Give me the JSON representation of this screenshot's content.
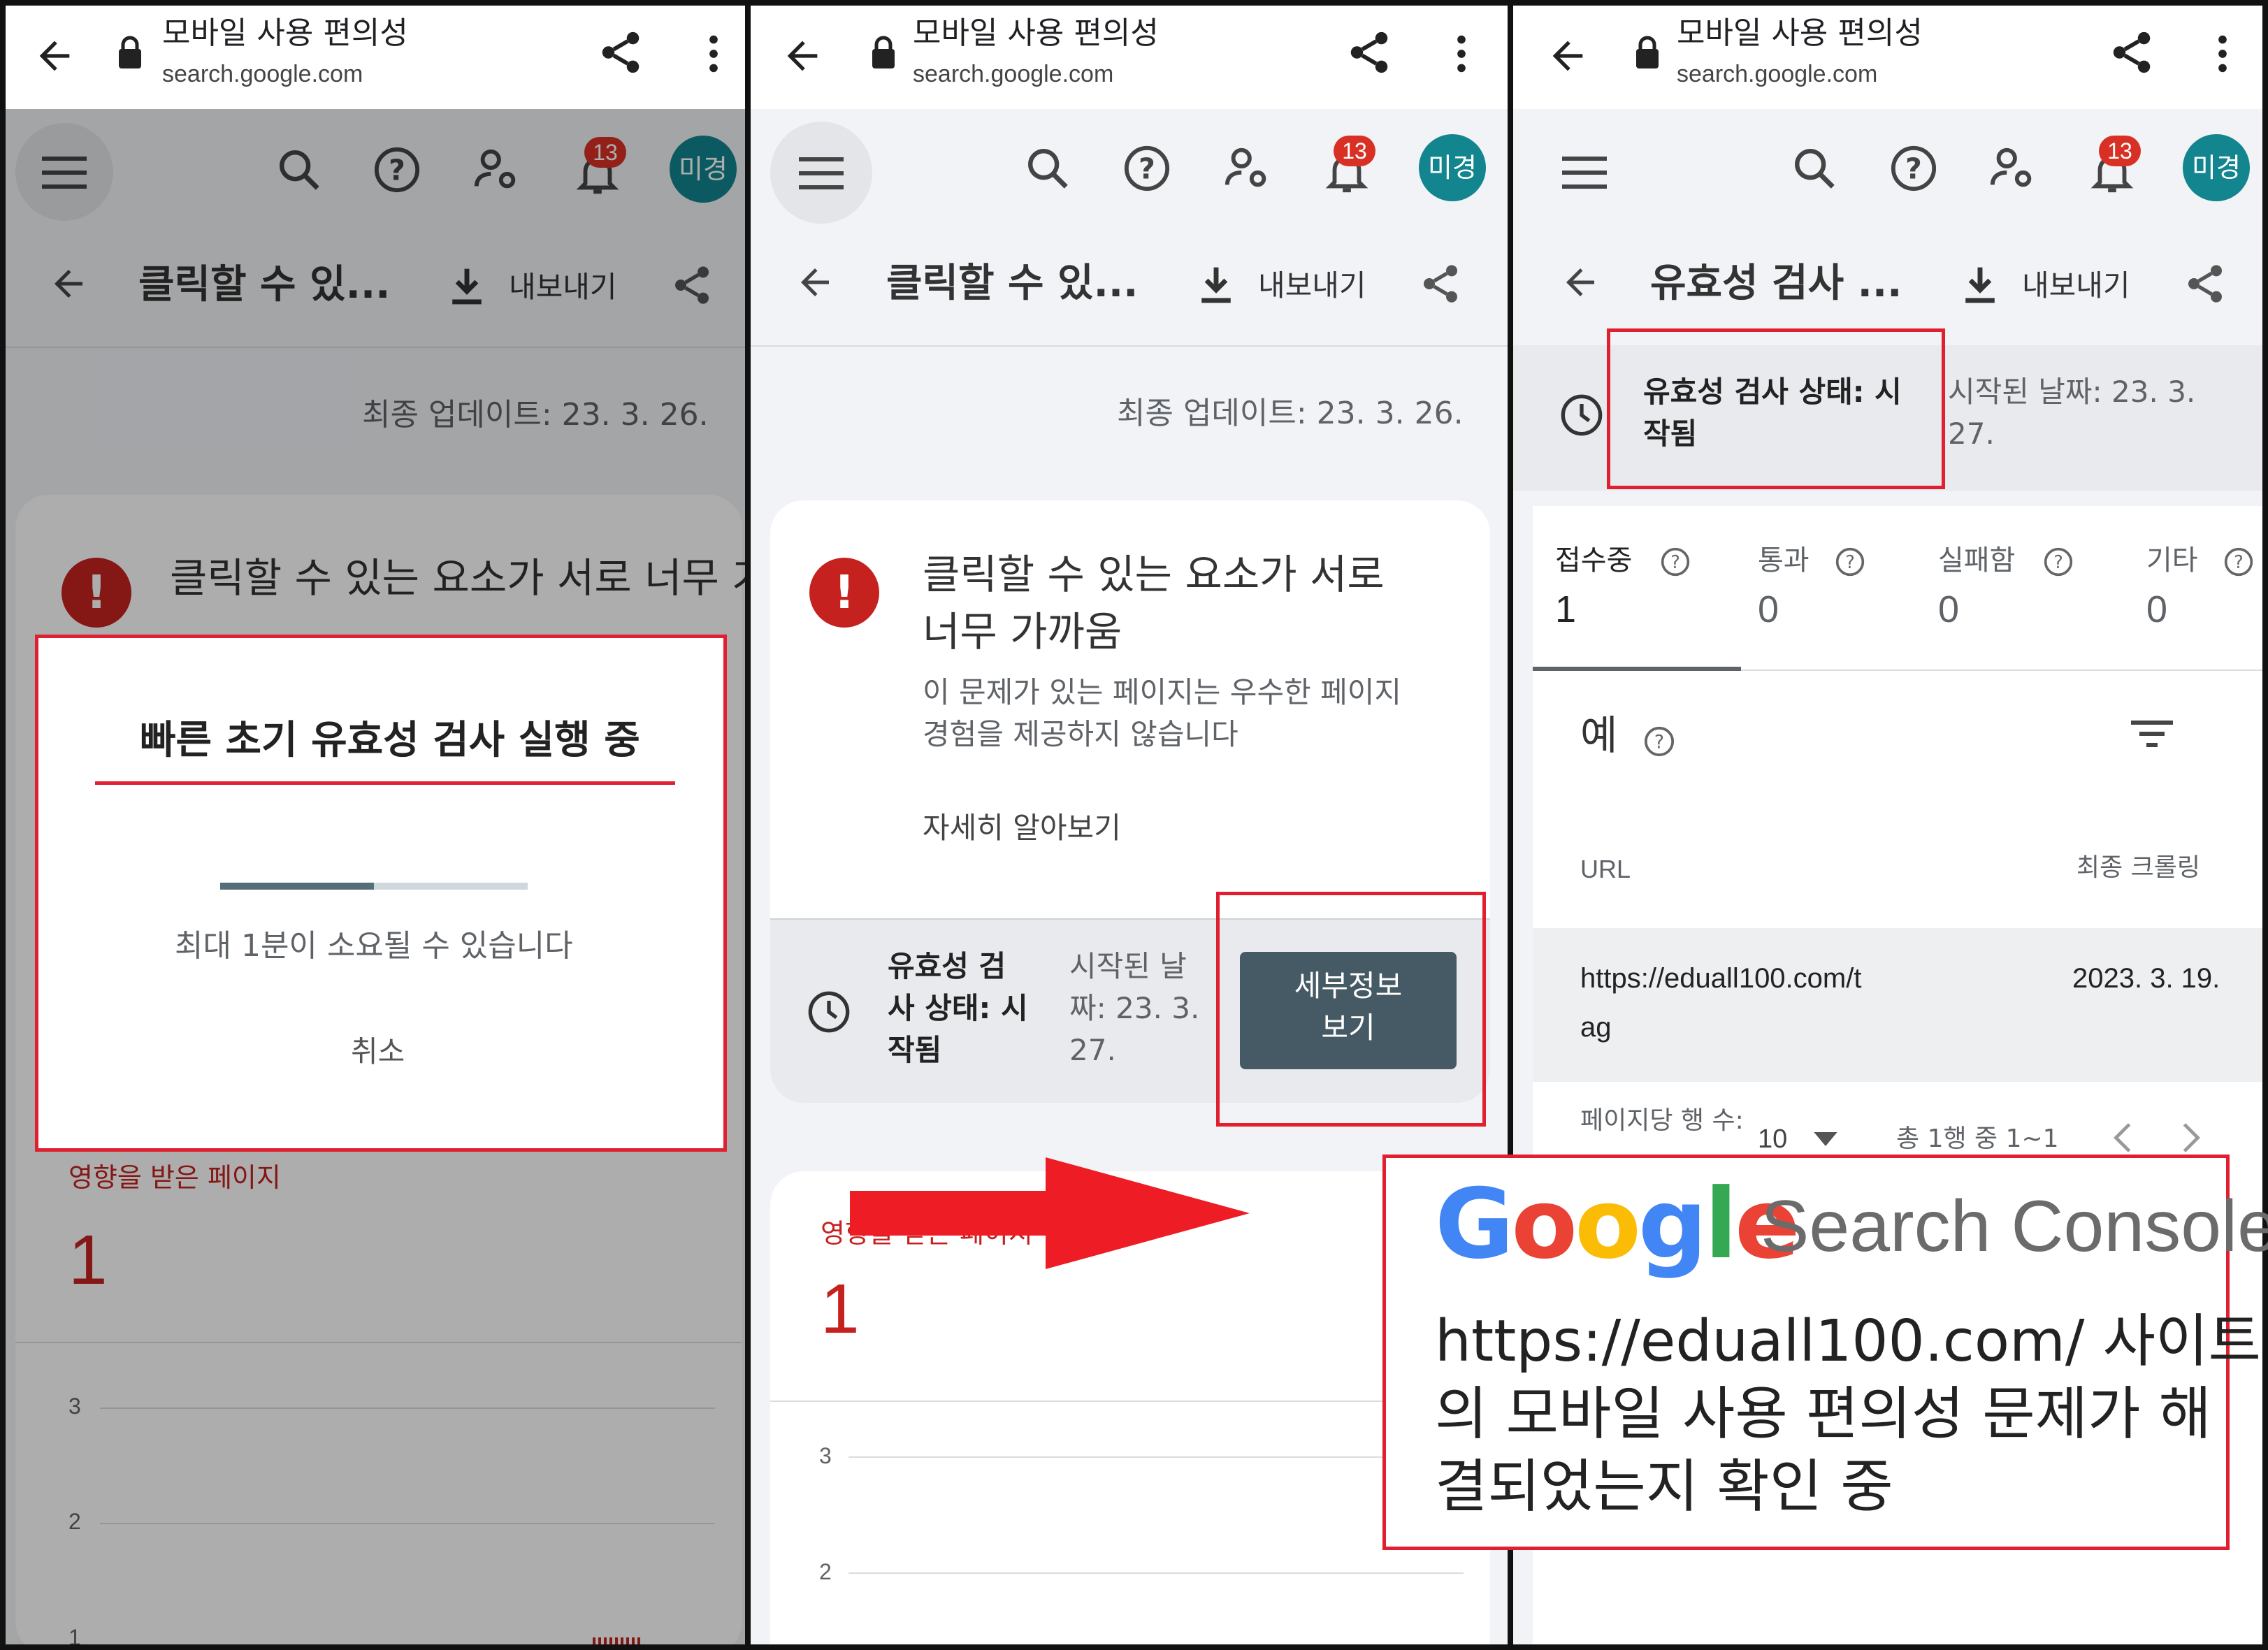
{
  "browser": {
    "page_title": "모바일 사용 편의성",
    "url": "search.google.com"
  },
  "app": {
    "notification_count": "13",
    "avatar_label": "미경"
  },
  "panel1": {
    "header_title": "클릭할 수 있...",
    "export_label": "내보내기",
    "last_updated": "최종 업데이트: 23. 3. 26.",
    "issue_title": "클릭할 수 있는 요소가 서로 너무 가까움",
    "dialog": {
      "title": "빠른 초기 유효성 검사 실행 중",
      "progress": 0.5,
      "note": "최대 1분이 소요될 수 있습니다",
      "cancel": "취소"
    },
    "affected_label": "영향을 받은 페이지",
    "affected_value": "1",
    "y_ticks": [
      "3",
      "2",
      "1"
    ]
  },
  "panel2": {
    "header_title": "클릭할 수 있...",
    "export_label": "내보내기",
    "last_updated": "최종 업데이트: 23. 3. 26.",
    "issue_title_line1": "클릭할 수 있는 요소가 서로",
    "issue_title_line2": "너무 가까움",
    "issue_desc_line1": "이 문제가 있는 페이지는 우수한 페이지",
    "issue_desc_line2": "경험을 제공하지 않습니다",
    "learn_more": "자세히 알아보기",
    "status_line1": "유효성 검",
    "status_line2": "사 상태: 시",
    "status_line3": "작됨",
    "started_line1": "시작된 날",
    "started_line2": "짜: 23. 3.",
    "started_line3": "27.",
    "details_btn_line1": "세부정보",
    "details_btn_line2": "보기",
    "affected_label": "영향을 받은 페이지",
    "affected_value": "1",
    "y_ticks": [
      "3",
      "2"
    ]
  },
  "panel3": {
    "header_title": "유효성 검사 ...",
    "export_label": "내보내기",
    "status_line1": "유효성 검사 상태: 시",
    "status_line2": "작됨",
    "started_line1": "시작된 날짜: 23. 3.",
    "started_line2": "27.",
    "tabs": [
      {
        "label": "접수중",
        "value": "1"
      },
      {
        "label": "통과",
        "value": "0"
      },
      {
        "label": "실패함",
        "value": "0"
      },
      {
        "label": "기타",
        "value": "0"
      }
    ],
    "examples_title": "예",
    "col_url": "URL",
    "col_crawl": "최종 크롤링",
    "row_url_line1": "https://eduall100.com/t",
    "row_url_line2": "ag",
    "row_date": "2023. 3. 19.",
    "rows_per_page_label": "페이지당 행 수:",
    "rows_per_page_value": "10",
    "range_label": "총 1행 중 1~1"
  },
  "annotation": {
    "brand_letters": [
      "G",
      "o",
      "o",
      "g",
      "l",
      "e"
    ],
    "brand_colors": [
      "#4285F4",
      "#EA4335",
      "#FBBC05",
      "#4285F4",
      "#34A853",
      "#EA4335"
    ],
    "product": "Search Console",
    "caption_line1": "https://eduall100.com/ 사이트",
    "caption_line2": "의 모바일 사용 편의성 문제가 해",
    "caption_line3": "결되었는지 확인 중",
    "arrow_color": "#ee1c24",
    "highlight_color": "#e02030"
  }
}
